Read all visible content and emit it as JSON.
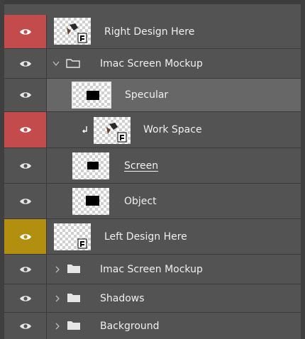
{
  "colors": {
    "panel_bg": "#535353",
    "selected_row": "#676767",
    "eye_red": "#c44b4b",
    "eye_yellow": "#b38f10",
    "eye_default": "#535353",
    "divider": "#3a3a3a"
  },
  "layers": [
    {
      "id": "right-design",
      "label": "Right Design Here",
      "eye_color": "red",
      "type": "smart-object"
    },
    {
      "id": "imac-group-1",
      "label": "Imac Screen Mockup",
      "eye_color": "default",
      "type": "group",
      "expanded": true
    },
    {
      "id": "specular",
      "label": "Specular",
      "eye_color": "default",
      "type": "layer",
      "selected": true
    },
    {
      "id": "work-space",
      "label": "Work Space",
      "eye_color": "red",
      "type": "smart-object",
      "clipped": true
    },
    {
      "id": "screen",
      "label": "Screen",
      "eye_color": "default",
      "type": "layer"
    },
    {
      "id": "object",
      "label": "Object",
      "eye_color": "default",
      "type": "layer"
    },
    {
      "id": "left-design",
      "label": "Left Design Here",
      "eye_color": "yellow",
      "type": "smart-object"
    },
    {
      "id": "imac-group-2",
      "label": "Imac Screen Mockup",
      "eye_color": "default",
      "type": "group",
      "expanded": false
    },
    {
      "id": "shadows",
      "label": "Shadows",
      "eye_color": "default",
      "type": "group",
      "expanded": false
    },
    {
      "id": "background",
      "label": "Background",
      "eye_color": "default",
      "type": "group",
      "expanded": false
    }
  ],
  "icons": {
    "visibility": "eye-icon",
    "group": "folder-icon",
    "expand_open": "chevron-down-icon",
    "expand_closed": "chevron-right-icon",
    "clip": "clipping-arrow-icon",
    "smart_object": "smart-object-badge-icon"
  }
}
